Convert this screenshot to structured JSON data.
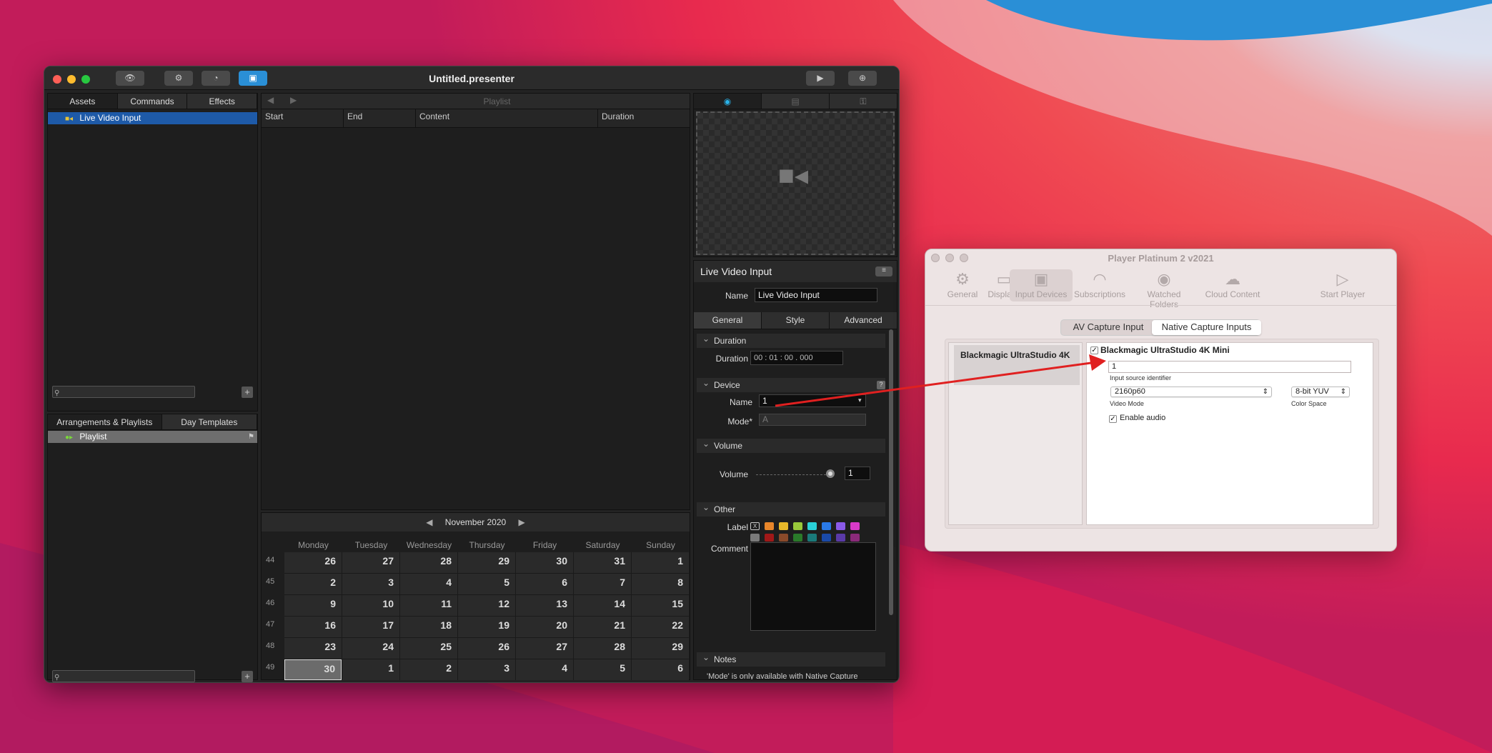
{
  "main_window": {
    "title": "Untitled.presenter",
    "toolbar": {
      "preview_icon": "eye-icon",
      "settings_icon": "gear-icon",
      "timer_icon": "clock-icon",
      "media_icon": "box-icon",
      "play_icon": "play-icon",
      "output_icon": "gamepad-icon"
    },
    "assets": {
      "tabs": [
        "Assets",
        "Commands",
        "Effects"
      ],
      "selected_tab": "Assets",
      "items": [
        {
          "label": "Live Video Input",
          "icon": "camera-icon"
        }
      ]
    },
    "arrangements": {
      "tabs": [
        "Arrangements & Playlists",
        "Day Templates"
      ],
      "items": [
        {
          "label": "Playlist",
          "icon": "playlist-icon"
        }
      ]
    },
    "playlist": {
      "title": "Playlist",
      "columns": [
        "Start",
        "End",
        "Content",
        "Duration"
      ]
    },
    "calendar": {
      "month": "November 2020",
      "days": [
        "Monday",
        "Tuesday",
        "Wednesday",
        "Thursday",
        "Friday",
        "Saturday",
        "Sunday"
      ],
      "weeks": [
        {
          "num": "44",
          "days": [
            "26",
            "27",
            "28",
            "29",
            "30",
            "31",
            "1"
          ]
        },
        {
          "num": "45",
          "days": [
            "2",
            "3",
            "4",
            "5",
            "6",
            "7",
            "8"
          ]
        },
        {
          "num": "46",
          "days": [
            "9",
            "10",
            "11",
            "12",
            "13",
            "14",
            "15"
          ]
        },
        {
          "num": "47",
          "days": [
            "16",
            "17",
            "18",
            "19",
            "20",
            "21",
            "22"
          ]
        },
        {
          "num": "48",
          "days": [
            "23",
            "24",
            "25",
            "26",
            "27",
            "28",
            "29"
          ]
        },
        {
          "num": "49",
          "days": [
            "30",
            "1",
            "2",
            "3",
            "4",
            "5",
            "6"
          ]
        }
      ],
      "today": "30"
    },
    "inspector": {
      "title": "Live Video Input",
      "name_label": "Name",
      "name_value": "Live Video Input",
      "tabs": [
        "General",
        "Style",
        "Advanced"
      ],
      "duration_section": "Duration",
      "duration_label": "Duration",
      "duration_value": "00 : 01 : 00 . 000",
      "device_section": "Device",
      "device_help": "?",
      "device_name_label": "Name",
      "device_name_value": "1",
      "mode_label": "Mode*",
      "mode_value": "A",
      "volume_section": "Volume",
      "volume_label": "Volume",
      "volume_value": "1",
      "other_section": "Other",
      "label_label": "Label",
      "label_none": "X",
      "comment_label": "Comment",
      "notes_section": "Notes",
      "notes_text": "'Mode' is only available with Native Capture"
    },
    "label_colors": [
      "#e8862a",
      "#e8b82a",
      "#98c83a",
      "#2ad0d8",
      "#2a7ae8",
      "#8a5ae8",
      "#d83ac8",
      "#7a7a7a",
      "#a01818",
      "#8a4a2a",
      "#2a7a2a",
      "#1a7a7a",
      "#1a4aa8",
      "#5a3aa8",
      "#8a2a7a"
    ]
  },
  "prefs_window": {
    "title": "Player Platinum 2 v2021",
    "toolbar": [
      {
        "label": "General",
        "icon": "gear-icon"
      },
      {
        "label": "Displays",
        "icon": "display-icon"
      },
      {
        "label": "Input Devices",
        "icon": "video-camera-icon"
      },
      {
        "label": "Subscriptions",
        "icon": "rss-icon"
      },
      {
        "label": "Watched Folders",
        "icon": "eye-folder-icon"
      },
      {
        "label": "Cloud Content",
        "icon": "cloud-icon"
      },
      {
        "label": "Start Player",
        "icon": "play-icon"
      }
    ],
    "selected_tool": "Input Devices",
    "segments": [
      "AV Capture Input",
      "Native Capture Inputs"
    ],
    "selected_segment": "Native Capture Inputs",
    "devices": [
      "Blackmagic UltraStudio 4K"
    ],
    "device_detail": {
      "enabled_label": "Blackmagic UltraStudio 4K Mini",
      "input_source_value": "1",
      "input_source_caption": "Input source identifier",
      "video_mode": "2160p60",
      "video_mode_caption": "Video Mode",
      "color_space": "8-bit YUV",
      "color_space_caption": "Color Space",
      "enable_audio": "Enable audio"
    }
  }
}
